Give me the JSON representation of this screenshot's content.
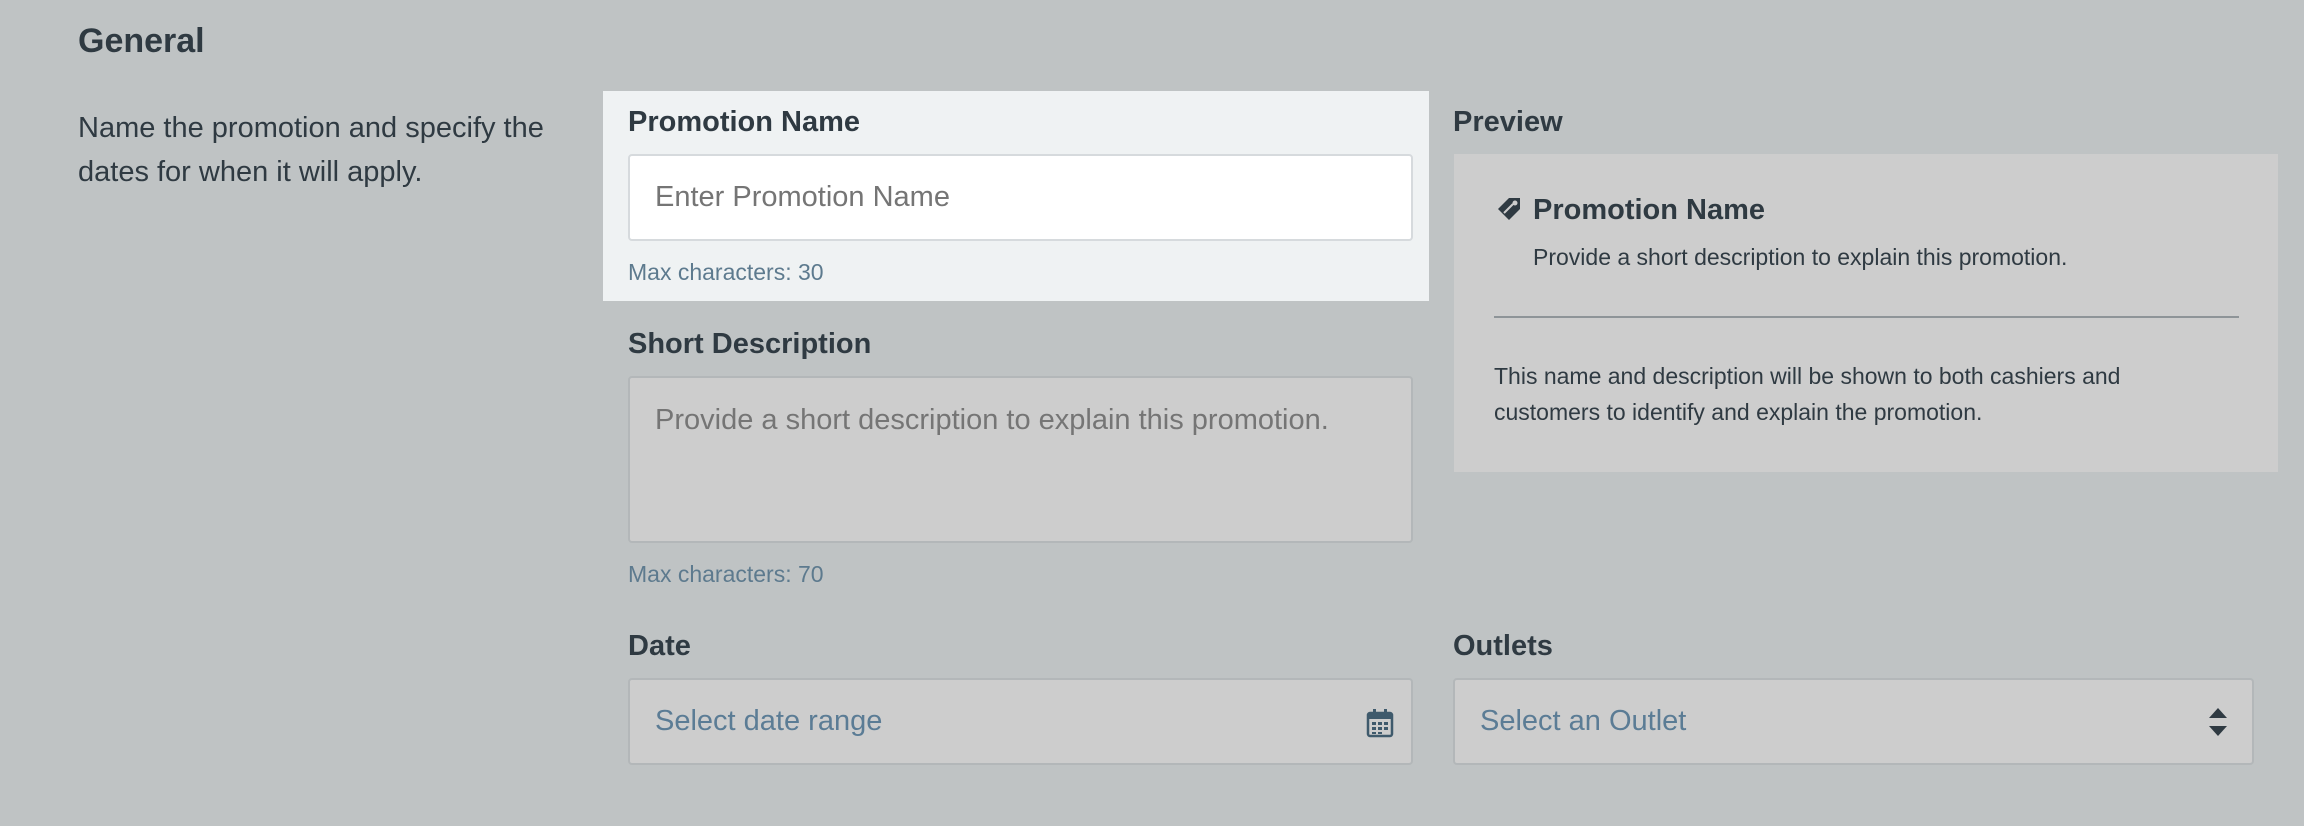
{
  "section": {
    "title": "General",
    "description": "Name the promotion and specify the dates for when it will apply."
  },
  "promotion_name": {
    "label": "Promotion Name",
    "placeholder": "Enter Promotion Name",
    "value": "",
    "hint": "Max characters: 30"
  },
  "short_description": {
    "label": "Short Description",
    "placeholder": "Provide a short description to explain this promotion.",
    "value": "",
    "hint": "Max characters: 70"
  },
  "preview": {
    "label": "Preview",
    "name": "Promotion Name",
    "description": "Provide a short description to explain this promotion.",
    "note": "This name and description will be shown to both cashiers and customers to identify and explain the promotion.",
    "icon": "tag-icon"
  },
  "date": {
    "label": "Date",
    "placeholder": "Select date range",
    "icon": "calendar-icon"
  },
  "outlets": {
    "label": "Outlets",
    "placeholder": "Select an Outlet",
    "icon": "sort-arrows-icon"
  },
  "colors": {
    "background": "#bfc3c4",
    "text": "#2f3a42",
    "placeholder": "#5b7c95",
    "hint": "#5d7a8e",
    "focus_card": "#eff2f3"
  }
}
